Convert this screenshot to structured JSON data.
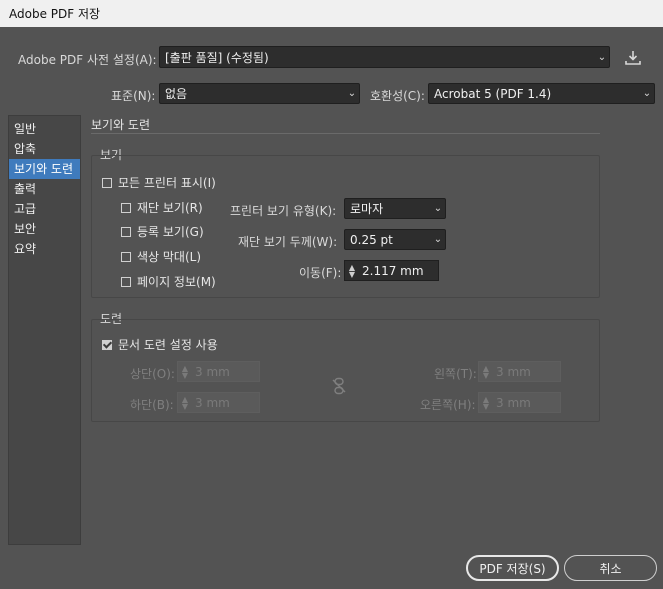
{
  "window": {
    "title": "Adobe PDF 저장"
  },
  "preset": {
    "label": "Adobe PDF 사전 설정(A):",
    "value": "[출판 품질] (수정됨)"
  },
  "standard": {
    "label": "표준(N):",
    "value": "없음"
  },
  "compat": {
    "label": "호환성(C):",
    "value": "Acrobat 5 (PDF 1.4)"
  },
  "sidebar": {
    "items": [
      {
        "label": "일반"
      },
      {
        "label": "압축"
      },
      {
        "label": "보기와 도련"
      },
      {
        "label": "출력"
      },
      {
        "label": "고급"
      },
      {
        "label": "보안"
      },
      {
        "label": "요약"
      }
    ]
  },
  "section": {
    "title": "보기와 도련"
  },
  "marks": {
    "title": "보기",
    "all": "모든 프린터 표시(I)",
    "trim": "재단 보기(R)",
    "reg": "등록 보기(G)",
    "color": "색상 막대(L)",
    "page": "페이지 정보(M)",
    "type_label": "프린터 보기 유형(K):",
    "type_value": "로마자",
    "weight_label": "재단 보기 두께(W):",
    "weight_value": "0.25 pt",
    "offset_label": "이동(F):",
    "offset_value": "2.117 mm"
  },
  "bleed": {
    "title": "도련",
    "use_doc": "문서 도련 설정 사용",
    "top_label": "상단(O):",
    "top_value": "3 mm",
    "bottom_label": "하단(B):",
    "bottom_value": "3 mm",
    "left_label": "왼쪽(T):",
    "left_value": "3 mm",
    "right_label": "오른쪽(H):",
    "right_value": "3 mm"
  },
  "buttons": {
    "save": "PDF 저장(S)",
    "cancel": "취소"
  }
}
